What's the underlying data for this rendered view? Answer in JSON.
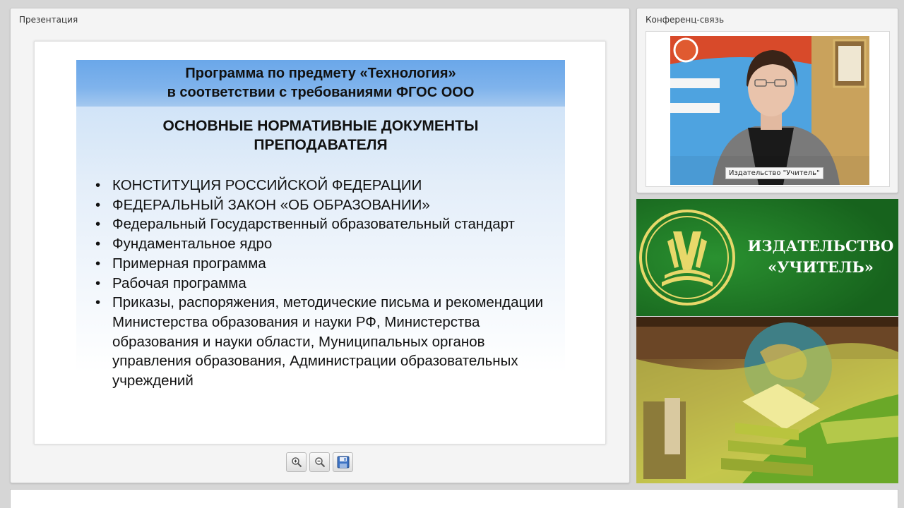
{
  "presentation": {
    "title": "Презентация",
    "slide": {
      "header_line1": "Программа по предмету  «Технология»",
      "header_line2": "в соответствии с требованиями ФГОС ООО",
      "subtitle_line1": "ОСНОВНЫЕ НОРМАТИВНЫЕ ДОКУМЕНТЫ",
      "subtitle_line2": "ПРЕПОДАВАТЕЛЯ",
      "items": [
        "КОНСТИТУЦИЯ РОССИЙСКОЙ ФЕДЕРАЦИИ",
        "ФЕДЕРАЛЬНЫЙ ЗАКОН «ОБ ОБРАЗОВАНИИ»",
        "Федеральный Государственный образовательный стандарт",
        "Фундаментальное ядро",
        "Примерная программа",
        "Рабочая программа",
        "Приказы, распоряжения, методические письма и рекомендации Министерства образования и науки РФ, Министерства образования и науки области, Муниципальных органов управления образования, Администрации образовательных учреждений"
      ]
    },
    "toolbar": {
      "zoom_in_icon": "zoom-in-icon",
      "zoom_out_icon": "zoom-out-icon",
      "save_icon": "floppy-disk-icon"
    }
  },
  "conference": {
    "title": "Конференц-связь",
    "video_caption": "Издательство \"Учитель\""
  },
  "publisher": {
    "name_line1": "ИЗДАТЕЛЬСТВО",
    "name_line2": "«УЧИТЕЛЬ»"
  },
  "colors": {
    "banner_green": "#1e7a26",
    "slide_header_blue": "#6aa7e9"
  }
}
